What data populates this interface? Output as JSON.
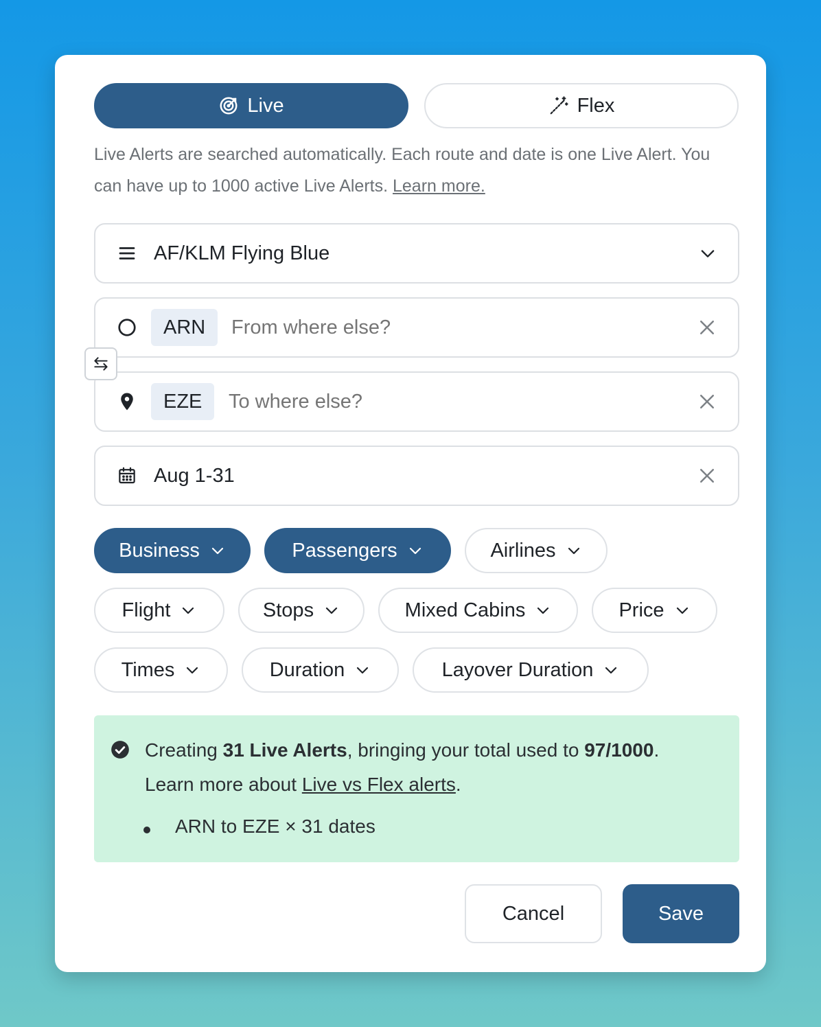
{
  "modes": {
    "live_label": "Live",
    "flex_label": "Flex",
    "active": "Live"
  },
  "description": {
    "text": "Live Alerts are searched automatically. Each route and date is one Live Alert. You can have up to 1000 active Live Alerts. ",
    "link": "Learn more."
  },
  "program": {
    "value": "AF/KLM Flying Blue"
  },
  "origin": {
    "chip": "ARN",
    "placeholder": "From where else?"
  },
  "destination": {
    "chip": "EZE",
    "placeholder": "To where else?"
  },
  "dates": {
    "value": "Aug 1-31"
  },
  "filters": [
    {
      "label": "Business",
      "active": true
    },
    {
      "label": "Passengers",
      "active": true
    },
    {
      "label": "Airlines",
      "active": false
    },
    {
      "label": "Flight",
      "active": false
    },
    {
      "label": "Stops",
      "active": false
    },
    {
      "label": "Mixed Cabins",
      "active": false
    },
    {
      "label": "Price",
      "active": false
    },
    {
      "label": "Times",
      "active": false
    },
    {
      "label": "Duration",
      "active": false
    },
    {
      "label": "Layover Duration",
      "active": false
    }
  ],
  "summary": {
    "prefix": "Creating ",
    "alerts_count": "31 Live Alerts",
    "middle": ", bringing your total used to ",
    "total_used": "97/1000",
    "suffix": ".",
    "learn_prefix": "Learn more about ",
    "learn_link": "Live vs Flex alerts",
    "learn_suffix": ".",
    "items": [
      "ARN to EZE × 31 dates"
    ]
  },
  "actions": {
    "cancel_label": "Cancel",
    "save_label": "Save"
  },
  "colors": {
    "primary": "#2d5d8a",
    "summary_bg": "#cff3e0",
    "chip_bg": "#e8eef6"
  }
}
